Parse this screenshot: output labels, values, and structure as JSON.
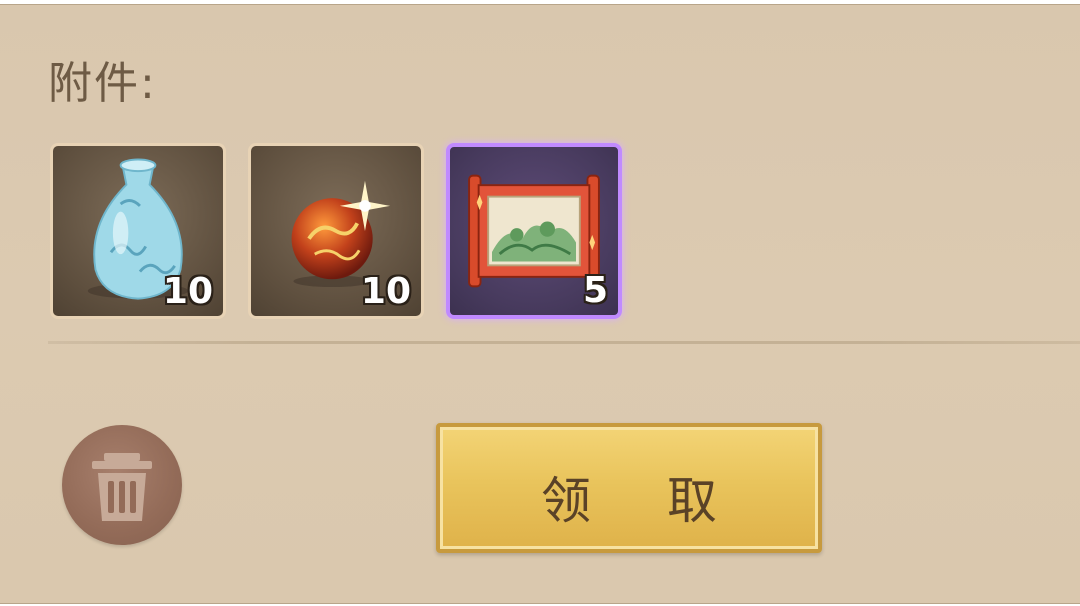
{
  "attachments": {
    "title": "附件:",
    "items": [
      {
        "icon": "blue-vase-icon",
        "count": "10",
        "rarity": "normal"
      },
      {
        "icon": "red-gold-orb-icon",
        "count": "10",
        "rarity": "normal"
      },
      {
        "icon": "landscape-scroll-icon",
        "count": "5",
        "rarity": "rare"
      }
    ]
  },
  "actions": {
    "delete_icon": "trash-icon",
    "claim_label": "领 取"
  },
  "colors": {
    "panel_bg": "#dccab1",
    "rare_border": "#c08aff",
    "button_gold": "#e9c45c",
    "trash_bg": "#936b58"
  }
}
